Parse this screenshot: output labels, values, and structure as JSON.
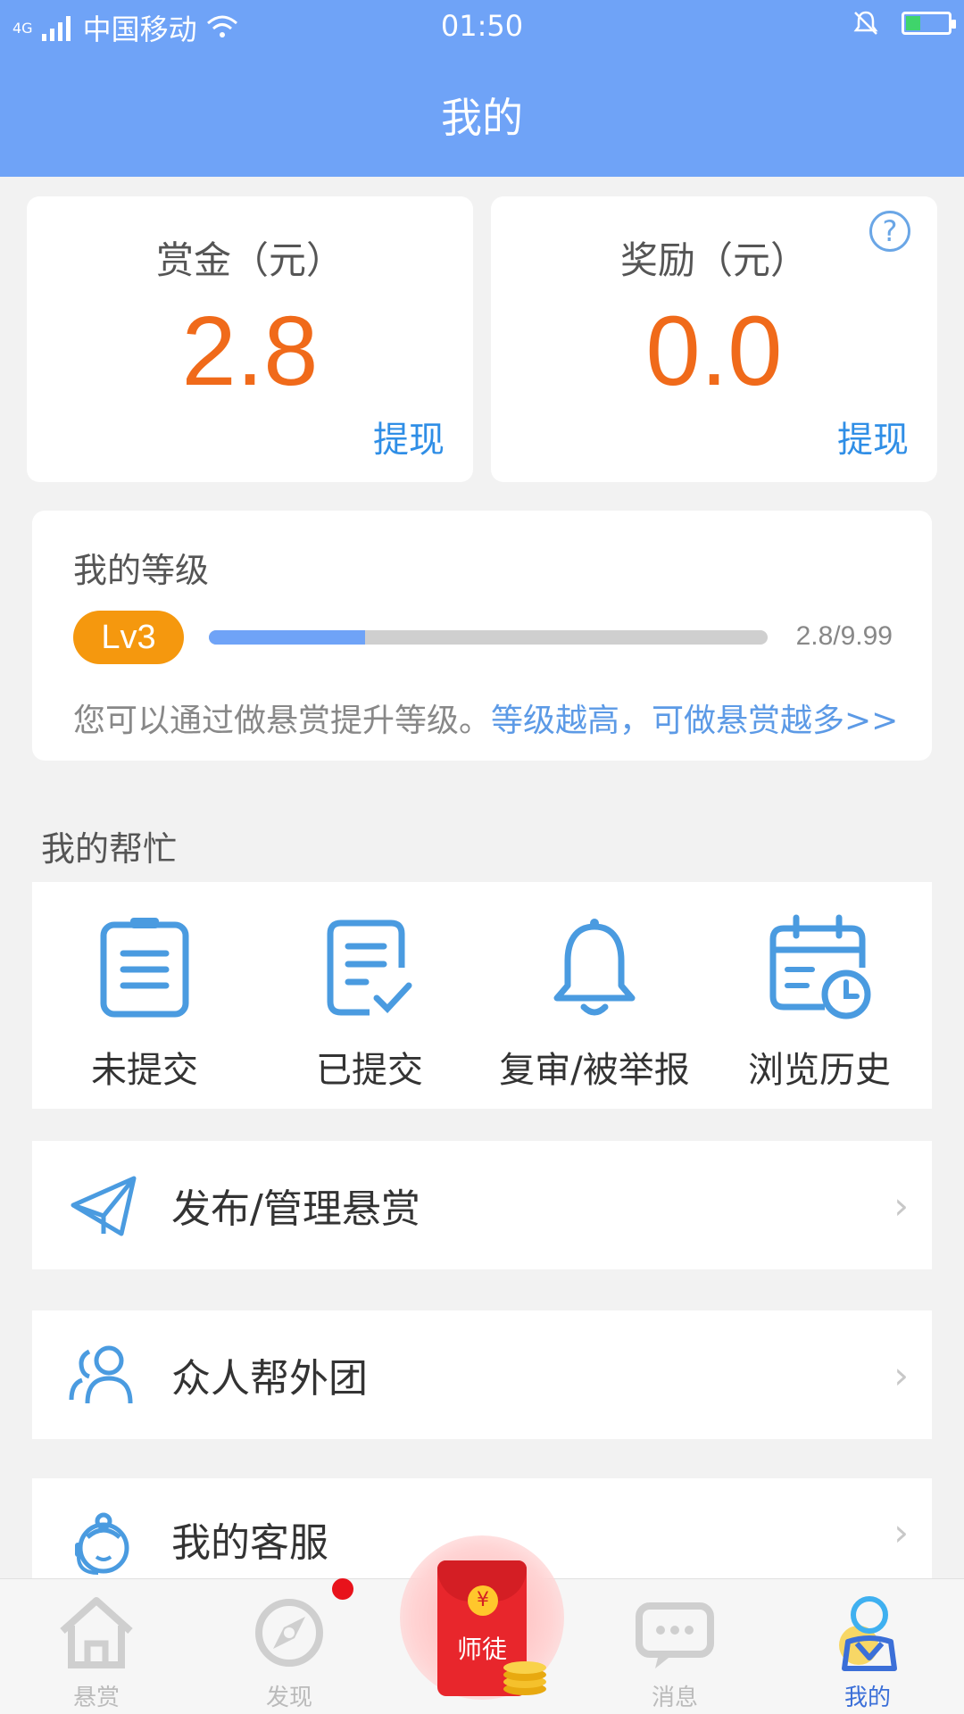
{
  "status": {
    "network": "4G",
    "carrier": "中国移动",
    "time": "01:50"
  },
  "header": {
    "title": "我的"
  },
  "bounty": {
    "label": "赏金（元）",
    "value": "2.8",
    "action": "提现"
  },
  "reward": {
    "label": "奖励（元）",
    "value": "0.0",
    "action": "提现",
    "help": "?"
  },
  "level": {
    "title": "我的等级",
    "badge": "Lv3",
    "progress_text": "2.8/9.99",
    "progress_fraction": 0.28,
    "hint": "您可以通过做悬赏提升等级。",
    "hint_link": "等级越高，可做悬赏越多>>"
  },
  "help_section": {
    "title": "我的帮忙",
    "items": [
      {
        "label": "未提交",
        "icon": "clipboard-icon"
      },
      {
        "label": "已提交",
        "icon": "checked-document-icon"
      },
      {
        "label": "复审/被举报",
        "icon": "bell-icon"
      },
      {
        "label": "浏览历史",
        "icon": "calendar-clock-icon"
      }
    ]
  },
  "menu": [
    {
      "label": "发布/管理悬赏",
      "icon": "paper-plane-icon"
    },
    {
      "label": "众人帮外团",
      "icon": "users-icon"
    },
    {
      "label": "我的客服",
      "icon": "customer-service-icon"
    }
  ],
  "chevron": "›",
  "tabbar": {
    "items": [
      {
        "label": "悬赏",
        "icon": "home-icon"
      },
      {
        "label": "发现",
        "icon": "compass-icon"
      },
      {
        "label": "师徒",
        "icon": "red-envelope-icon"
      },
      {
        "label": "消息",
        "icon": "chat-icon"
      },
      {
        "label": "我的",
        "icon": "profile-icon"
      }
    ],
    "active": "我的"
  },
  "colors": {
    "primary": "#6fa3f7",
    "money": "#f06a1a",
    "link": "#2f8ee6",
    "badge": "#f5980e",
    "icon": "#4a9be0"
  }
}
